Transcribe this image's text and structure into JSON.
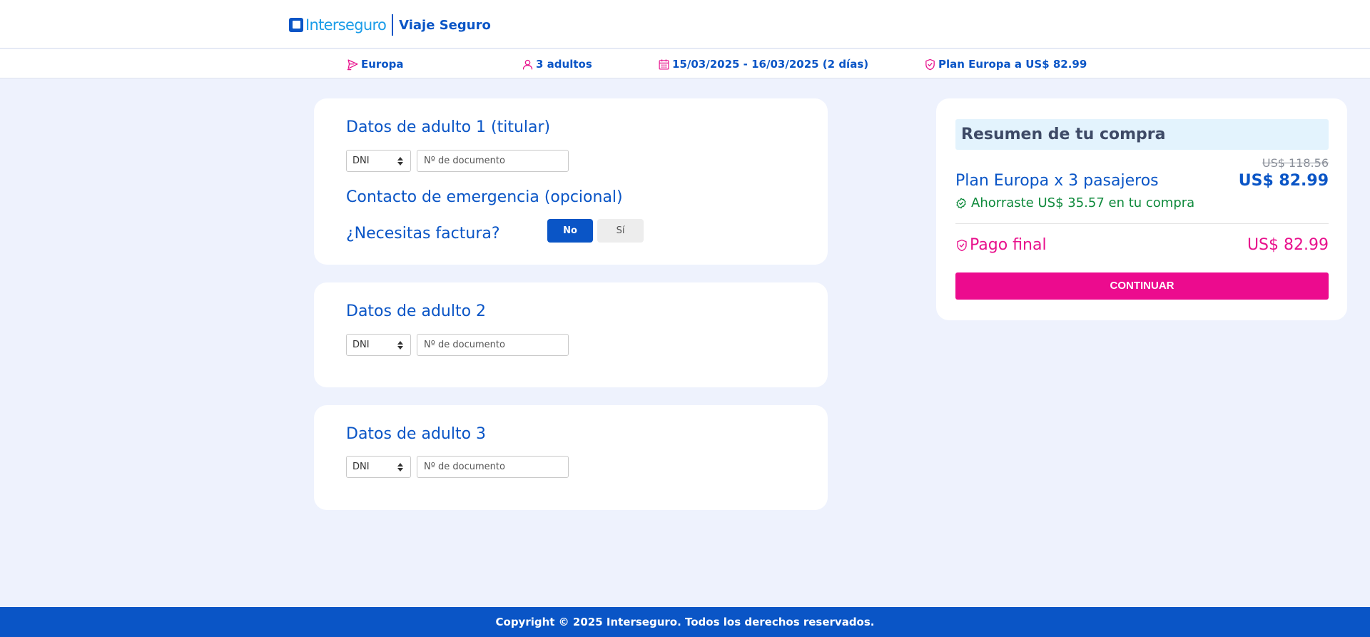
{
  "header": {
    "brand": "Interseguro",
    "product": "Viaje Seguro"
  },
  "trip": {
    "destination": "Europa",
    "travelers": "3 adultos",
    "dates": "15/03/2025 - 16/03/2025 (2 días)",
    "plan": "Plan Europa a US$ 82.99",
    "icons": [
      "plane-icon",
      "user-icon",
      "calendar-icon",
      "shield-icon"
    ]
  },
  "forms": {
    "adult1": {
      "title": "Datos de adulto 1 (titular)",
      "doc_type": "DNI",
      "doc_placeholder": "Nº de documento",
      "emergency_title": "Contacto de emergencia (opcional)",
      "invoice_question": "¿Necesitas factura?",
      "invoice_no": "No",
      "invoice_yes": "Sí",
      "invoice_selected": "No"
    },
    "adult2": {
      "title": "Datos de adulto 2",
      "doc_type": "DNI",
      "doc_placeholder": "Nº de documento"
    },
    "adult3": {
      "title": "Datos de adulto 3",
      "doc_type": "DNI",
      "doc_placeholder": "Nº de documento"
    }
  },
  "summary": {
    "title": "Resumen de tu compra",
    "old_price": "US$ 118.56",
    "plan_label": "Plan Europa x 3 pasajeros",
    "plan_price": "US$ 82.99",
    "saving": "Ahorraste US$ 35.57 en tu compra",
    "final_label": "Pago final",
    "final_price": "US$ 82.99",
    "cta": "CONTINUAR"
  },
  "footer": {
    "copyright": "Copyright © 2025 Interseguro. Todos los derechos reservados."
  },
  "colors": {
    "primary": "#0a55c6",
    "accent": "#ec0b8e",
    "success": "#0f8a3c",
    "background": "#eef2fd",
    "brand_light": "#1a9ce8"
  }
}
